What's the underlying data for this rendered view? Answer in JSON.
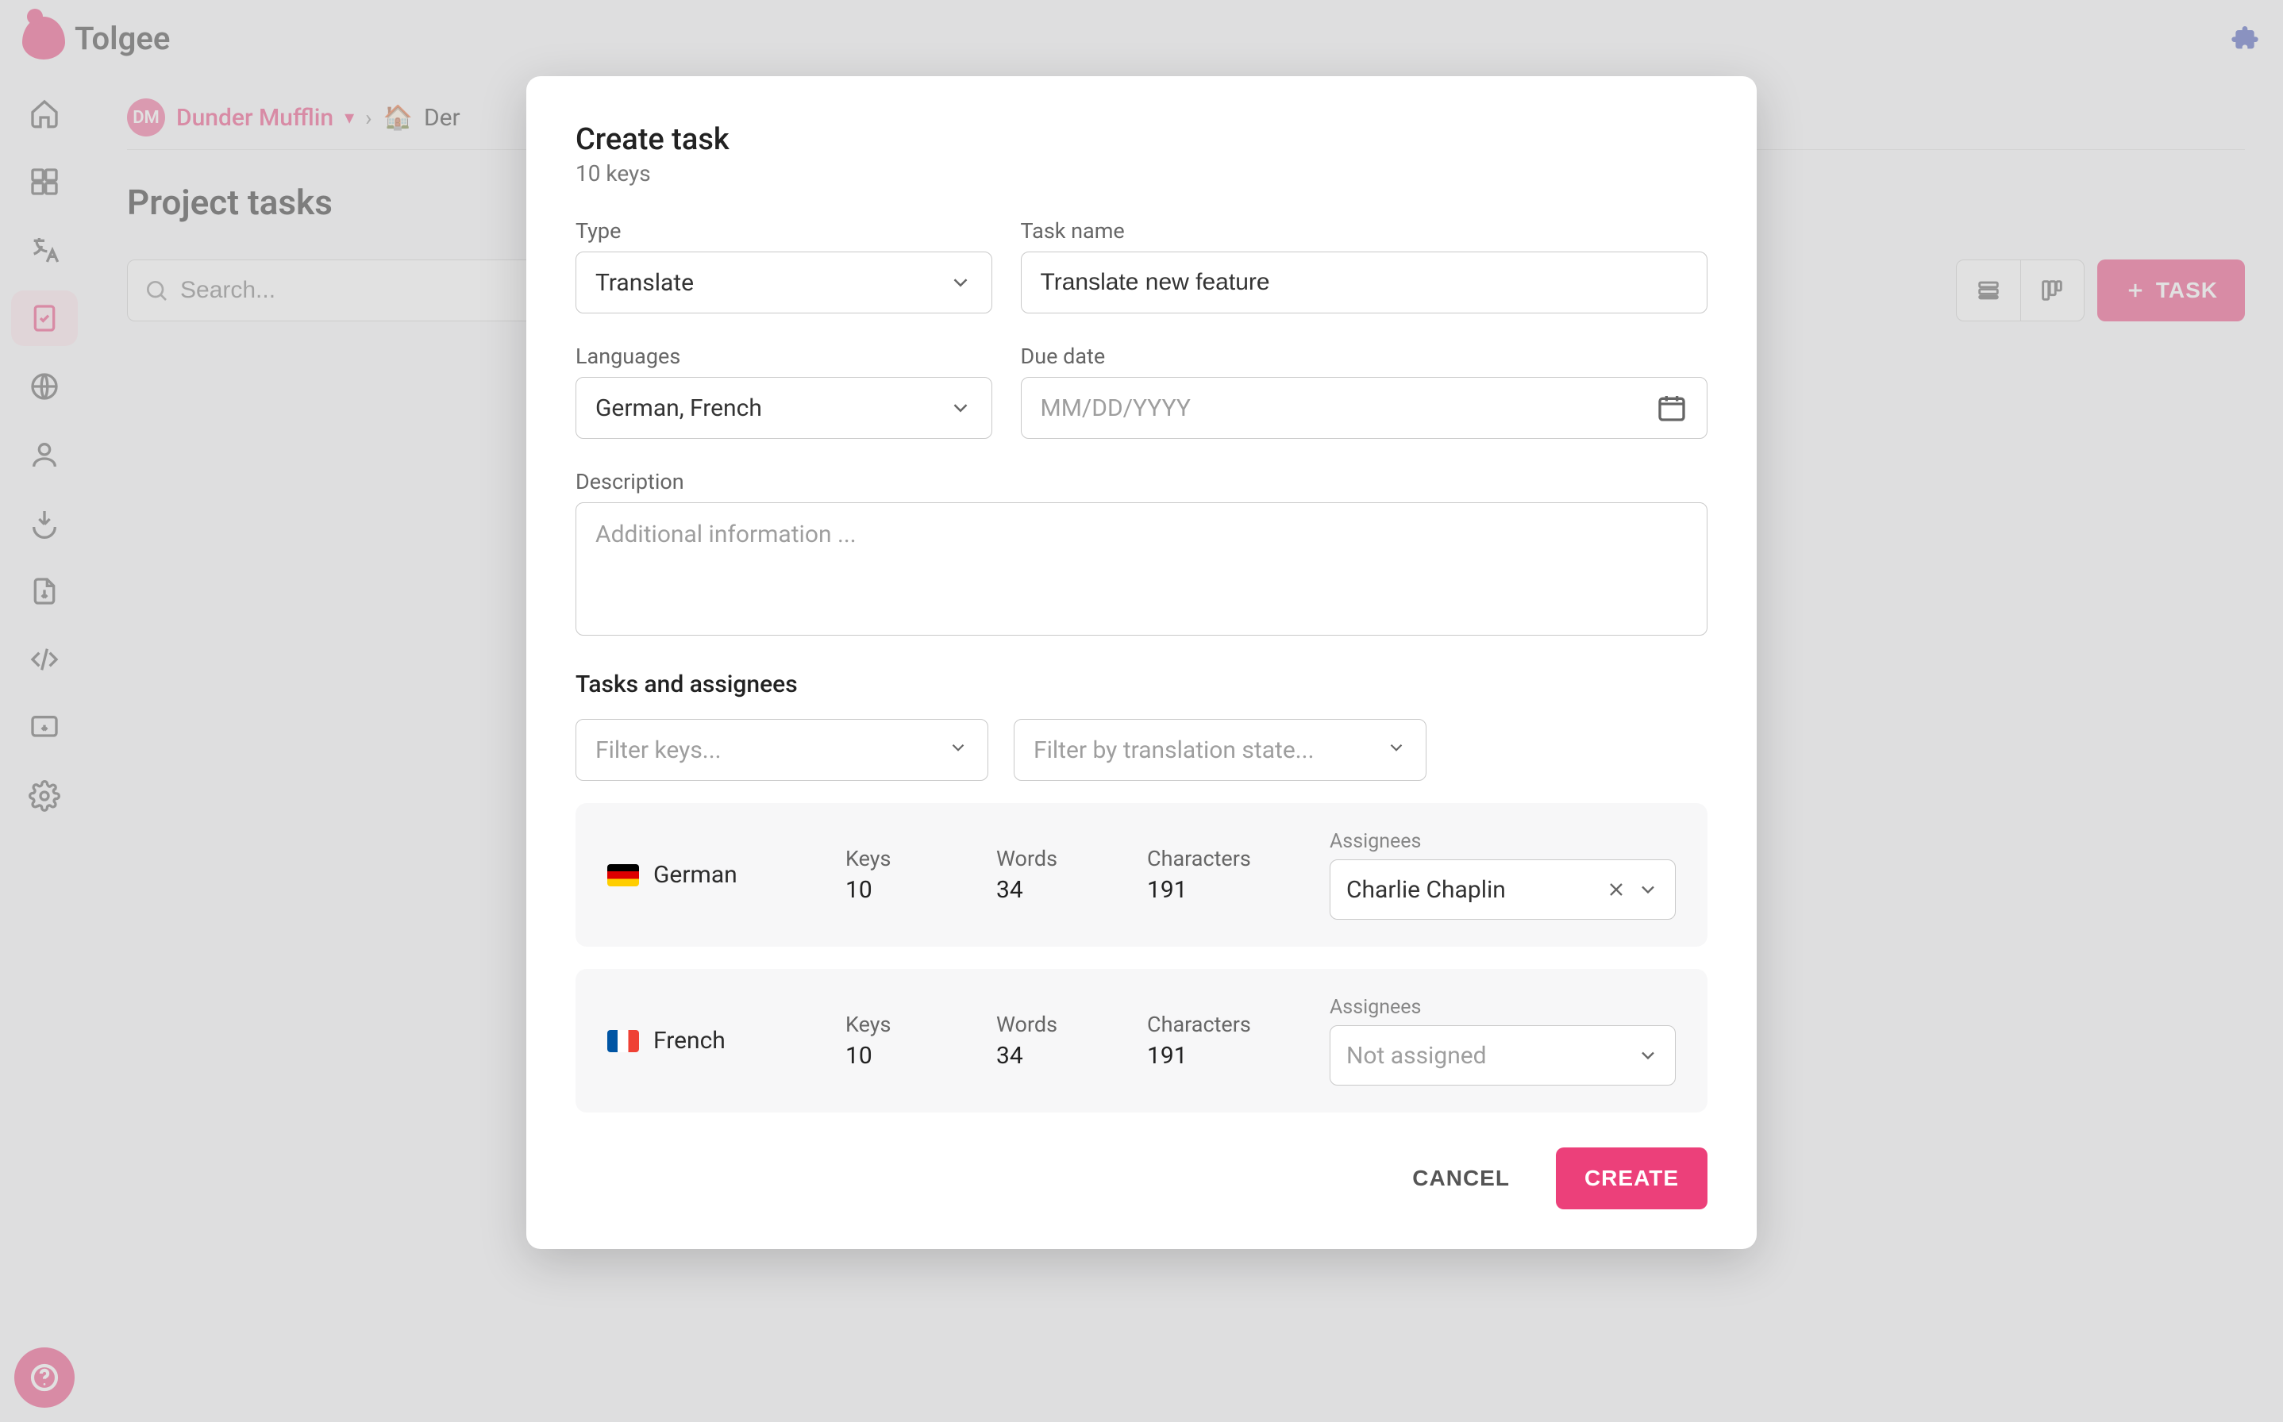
{
  "brand": {
    "name": "Tolgee"
  },
  "breadcrumb": {
    "org_initials": "DM",
    "org_name": "Dunder Mufflin",
    "project_prefix": "Der"
  },
  "page": {
    "title": "Project tasks"
  },
  "toolbar": {
    "search_placeholder": "Search...",
    "task_button": "TASK"
  },
  "dialog": {
    "title": "Create task",
    "subtitle": "10 keys",
    "type_label": "Type",
    "type_value": "Translate",
    "name_label": "Task name",
    "name_value": "Translate new feature",
    "languages_label": "Languages",
    "languages_value": "German, French",
    "due_label": "Due date",
    "due_placeholder": "MM/DD/YYYY",
    "description_label": "Description",
    "description_placeholder": "Additional information ...",
    "section_title": "Tasks and assignees",
    "filter_keys_placeholder": "Filter keys...",
    "filter_state_placeholder": "Filter by translation state...",
    "stats_labels": {
      "keys": "Keys",
      "words": "Words",
      "chars": "Characters"
    },
    "assignees_label": "Assignees",
    "not_assigned": "Not assigned",
    "languages": [
      {
        "flag": "de",
        "name": "German",
        "keys": "10",
        "words": "34",
        "chars": "191",
        "assignee": "Charlie Chaplin"
      },
      {
        "flag": "fr",
        "name": "French",
        "keys": "10",
        "words": "34",
        "chars": "191",
        "assignee": null
      }
    ],
    "cancel": "CANCEL",
    "create": "CREATE"
  }
}
